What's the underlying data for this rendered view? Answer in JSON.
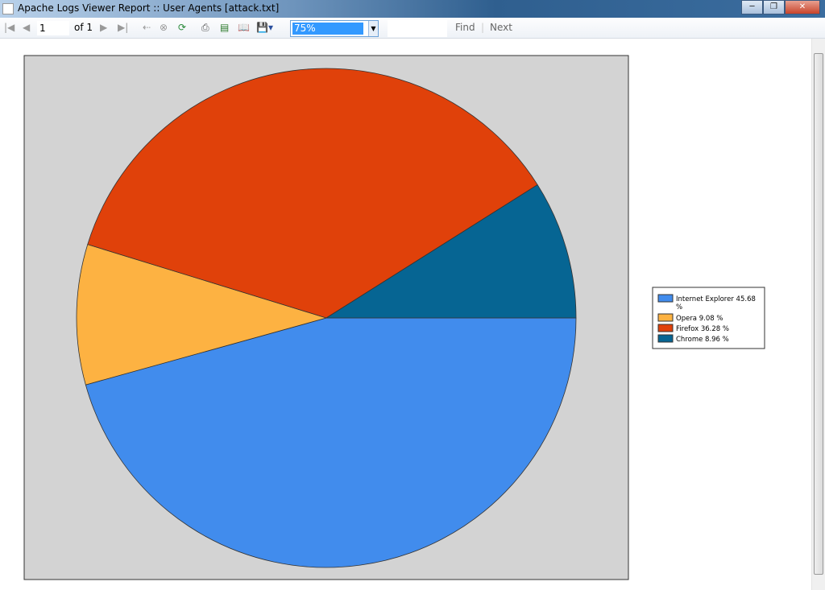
{
  "window": {
    "title": "Apache Logs Viewer Report :: User Agents [attack.txt]"
  },
  "toolbar": {
    "page": "1",
    "of_label": "of 1",
    "zoom": "75%",
    "find": "Find",
    "next": "Next"
  },
  "chart_data": {
    "type": "pie",
    "categories": [
      "Internet Explorer",
      "Opera",
      "Firefox",
      "Chrome"
    ],
    "values": [
      45.68,
      9.08,
      36.28,
      8.96
    ],
    "labels": [
      "Internet Explorer  45.68 %",
      "Opera  9.08 %",
      "Firefox  36.28 %",
      "Chrome  8.96 %"
    ],
    "colors": [
      "#418ced",
      "#fdb242",
      "#e0410a",
      "#066593"
    ],
    "background": "#d3d3d3",
    "legend_placement": "right"
  }
}
